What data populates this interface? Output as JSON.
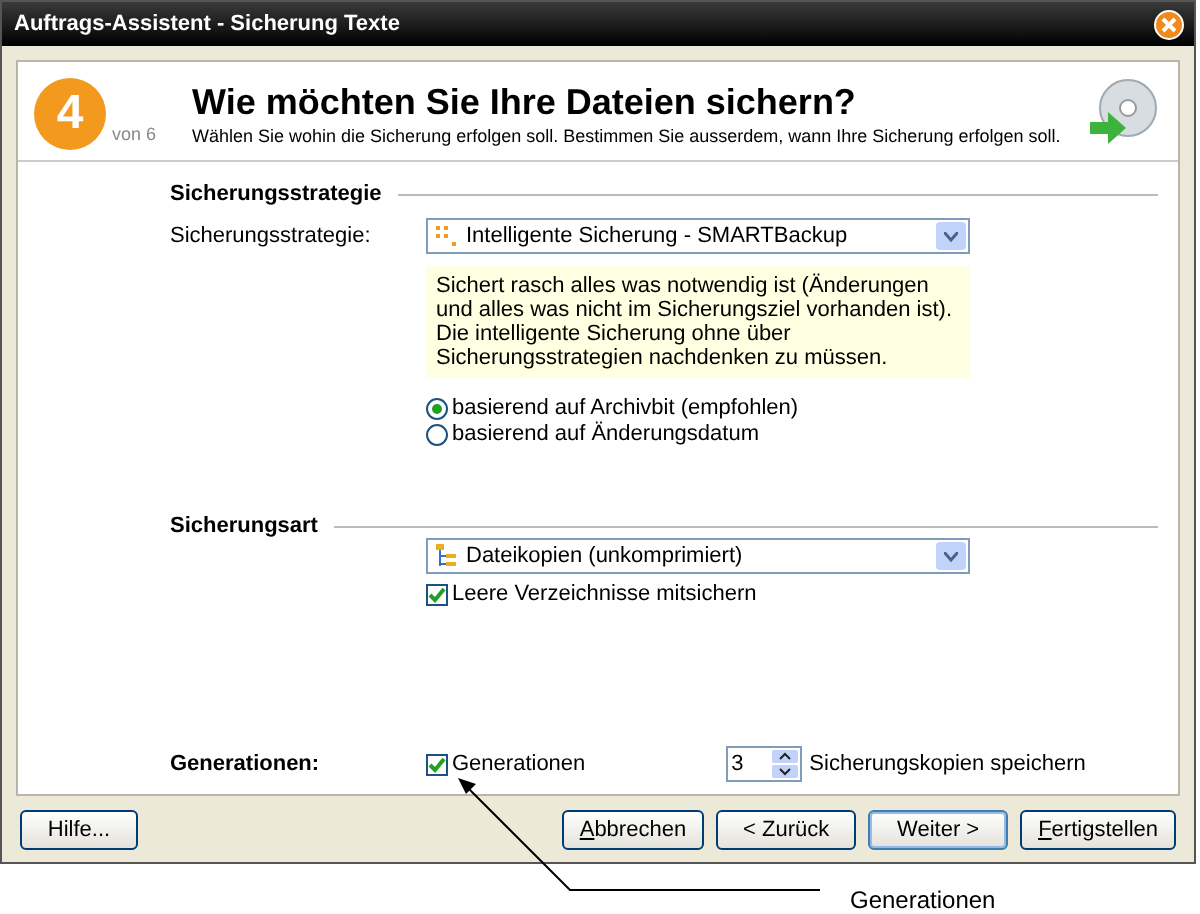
{
  "window": {
    "title": "Auftrags-Assistent - Sicherung Texte"
  },
  "header": {
    "step": "4",
    "step_total": "von 6",
    "title": "Wie möchten Sie Ihre Dateien sichern?",
    "subtitle": "Wählen Sie wohin die Sicherung erfolgen soll. Bestimmen Sie ausserdem, wann Ihre Sicherung erfolgen soll."
  },
  "strategy": {
    "heading": "Sicherungsstrategie",
    "label": "Sicherungsstrategie:",
    "value": "Intelligente Sicherung - SMARTBackup",
    "info": "Sichert rasch alles was notwendig ist (Änderungen und alles was nicht im Sicherungsziel vorhanden ist). Die intelligente Sicherung ohne über Sicherungsstrategien nachdenken zu müssen.",
    "options": [
      {
        "label": "basierend auf Archivbit (empfohlen)",
        "selected": true
      },
      {
        "label": "basierend auf Änderungsdatum",
        "selected": false
      }
    ]
  },
  "type": {
    "heading": "Sicherungsart",
    "value": "Dateikopien (unkomprimiert)",
    "empty_dirs": {
      "label": "Leere Verzeichnisse mitsichern",
      "checked": true
    }
  },
  "generations": {
    "label": "Generationen:",
    "checkbox": {
      "label": "Generationen",
      "checked": true
    },
    "copies": "3",
    "copies_label": "Sicherungskopien speichern"
  },
  "buttons": [
    {
      "label": "Hilfe...",
      "mnemonic": false,
      "default": false
    },
    {
      "label": "Abbrechen",
      "mnemonic": true,
      "default": false
    },
    {
      "label": "< Zurück",
      "mnemonic": false,
      "default": false
    },
    {
      "label": "Weiter >",
      "mnemonic": false,
      "default": true
    },
    {
      "label": "Fertigstellen",
      "mnemonic": true,
      "default": false
    }
  ],
  "callout": {
    "label": "Generationen"
  }
}
